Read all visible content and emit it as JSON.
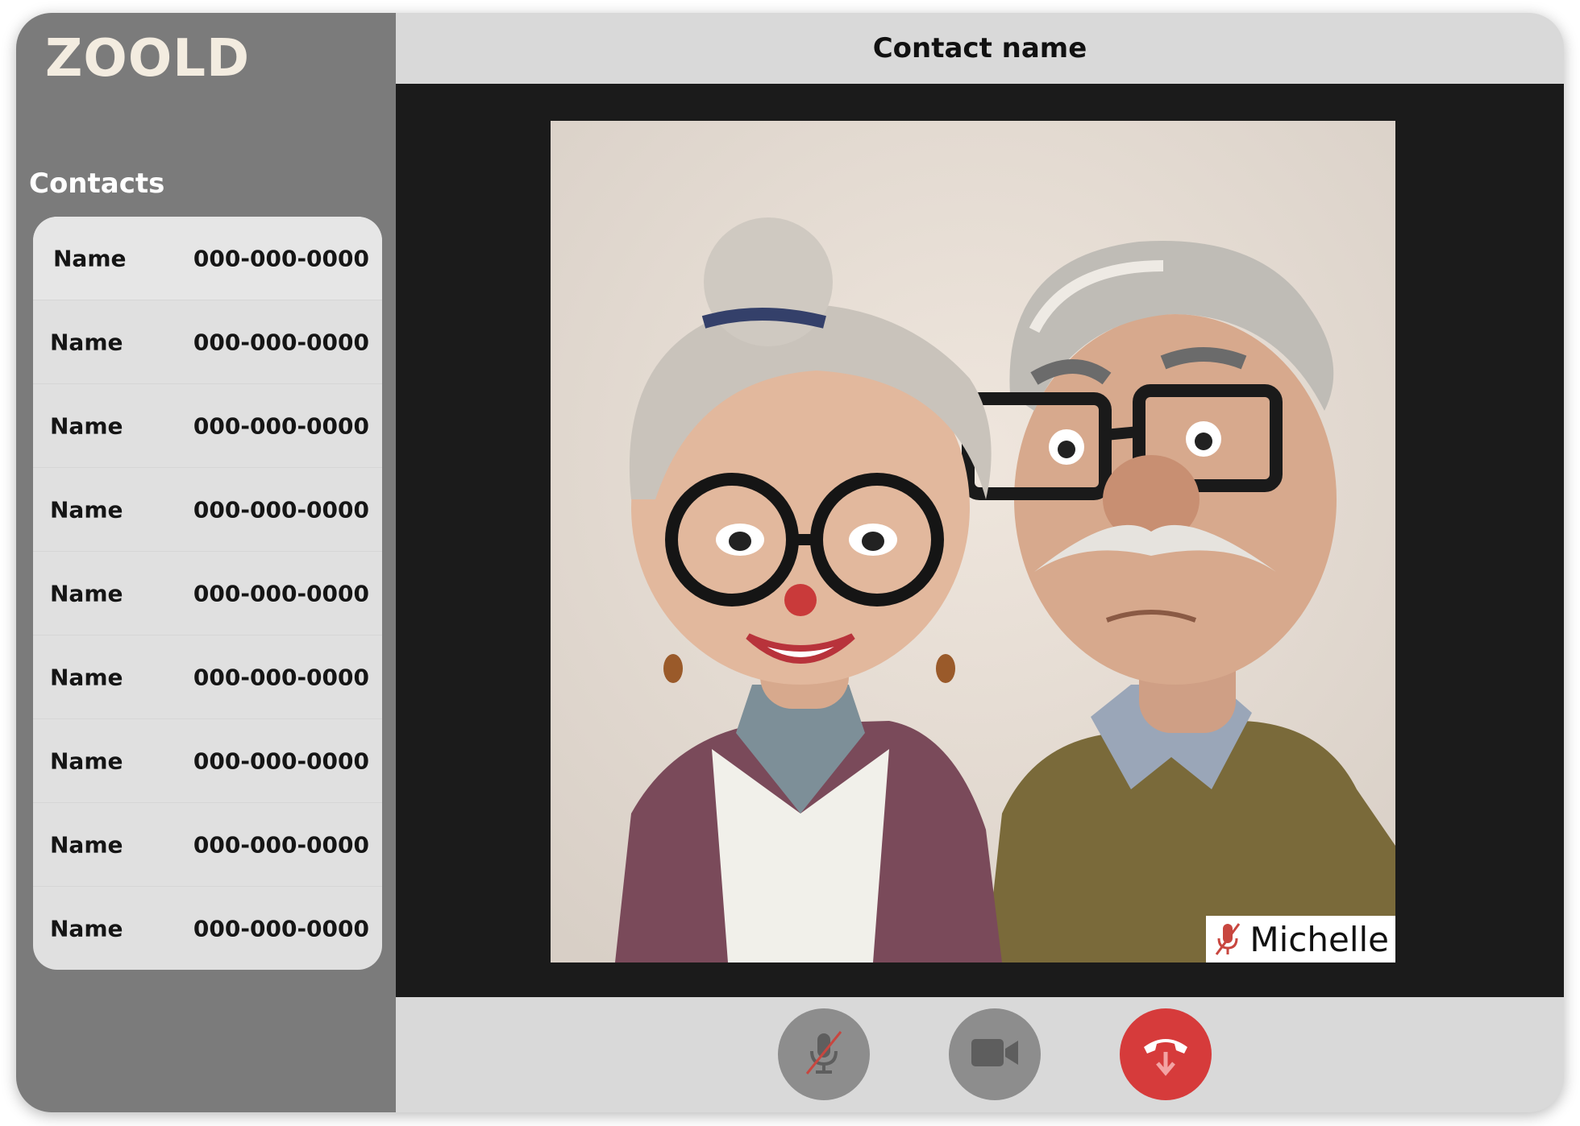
{
  "app": {
    "logo": "ZOOLD"
  },
  "sidebar": {
    "heading": "Contacts",
    "contacts": [
      {
        "name": "Name",
        "phone": "000-000-0000"
      },
      {
        "name": "Name",
        "phone": "000-000-0000"
      },
      {
        "name": "Name",
        "phone": "000-000-0000"
      },
      {
        "name": "Name",
        "phone": "000-000-0000"
      },
      {
        "name": "Name",
        "phone": "000-000-0000"
      },
      {
        "name": "Name",
        "phone": "000-000-0000"
      },
      {
        "name": "Name",
        "phone": "000-000-0000"
      },
      {
        "name": "Name",
        "phone": "000-000-0000"
      },
      {
        "name": "Name",
        "phone": "000-000-0000"
      }
    ]
  },
  "call": {
    "title": "Contact name",
    "participant": {
      "name": "Michelle",
      "muted": true,
      "mute_icon": "mic-muted-icon"
    }
  },
  "controls": {
    "mute_icon": "mic-off-icon",
    "camera_icon": "video-camera-icon",
    "end_icon": "end-call-icon"
  },
  "colors": {
    "sidebar": "#7b7b7b",
    "surface": "#d9d9d9",
    "video_bg": "#1b1b1b",
    "end_call": "#d63b3b",
    "control": "#8d8d8d",
    "logo": "#f3ece0"
  }
}
